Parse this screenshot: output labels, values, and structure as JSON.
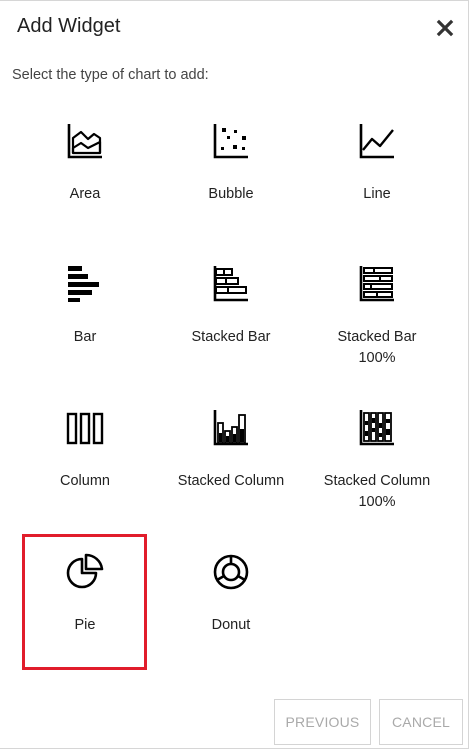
{
  "dialog": {
    "title": "Add Widget",
    "close_icon": "close-icon",
    "subtitle": "Select the type of chart to add:"
  },
  "chart_types": [
    {
      "id": "area",
      "label": "Area",
      "icon": "area-chart-icon"
    },
    {
      "id": "bubble",
      "label": "Bubble",
      "icon": "bubble-chart-icon"
    },
    {
      "id": "line",
      "label": "Line",
      "icon": "line-chart-icon"
    },
    {
      "id": "bar",
      "label": "Bar",
      "icon": "bar-chart-icon"
    },
    {
      "id": "stacked-bar",
      "label": "Stacked Bar",
      "icon": "stacked-bar-chart-icon"
    },
    {
      "id": "stacked-bar-100",
      "label": "Stacked Bar 100%",
      "label_line1": "Stacked Bar",
      "label_line2": "100%",
      "icon": "stacked-bar-100-chart-icon"
    },
    {
      "id": "column",
      "label": "Column",
      "icon": "column-chart-icon"
    },
    {
      "id": "stacked-column",
      "label": "Stacked Column",
      "icon": "stacked-column-chart-icon"
    },
    {
      "id": "stacked-column-100",
      "label": "Stacked Column 100%",
      "label_line1": "Stacked Column",
      "label_line2": "100%",
      "icon": "stacked-column-100-chart-icon"
    },
    {
      "id": "pie",
      "label": "Pie",
      "icon": "pie-chart-icon",
      "selected": true
    },
    {
      "id": "donut",
      "label": "Donut",
      "icon": "donut-chart-icon"
    }
  ],
  "selection_color": "#e11d2b",
  "footer": {
    "previous_label": "PREVIOUS",
    "cancel_label": "CANCEL"
  }
}
